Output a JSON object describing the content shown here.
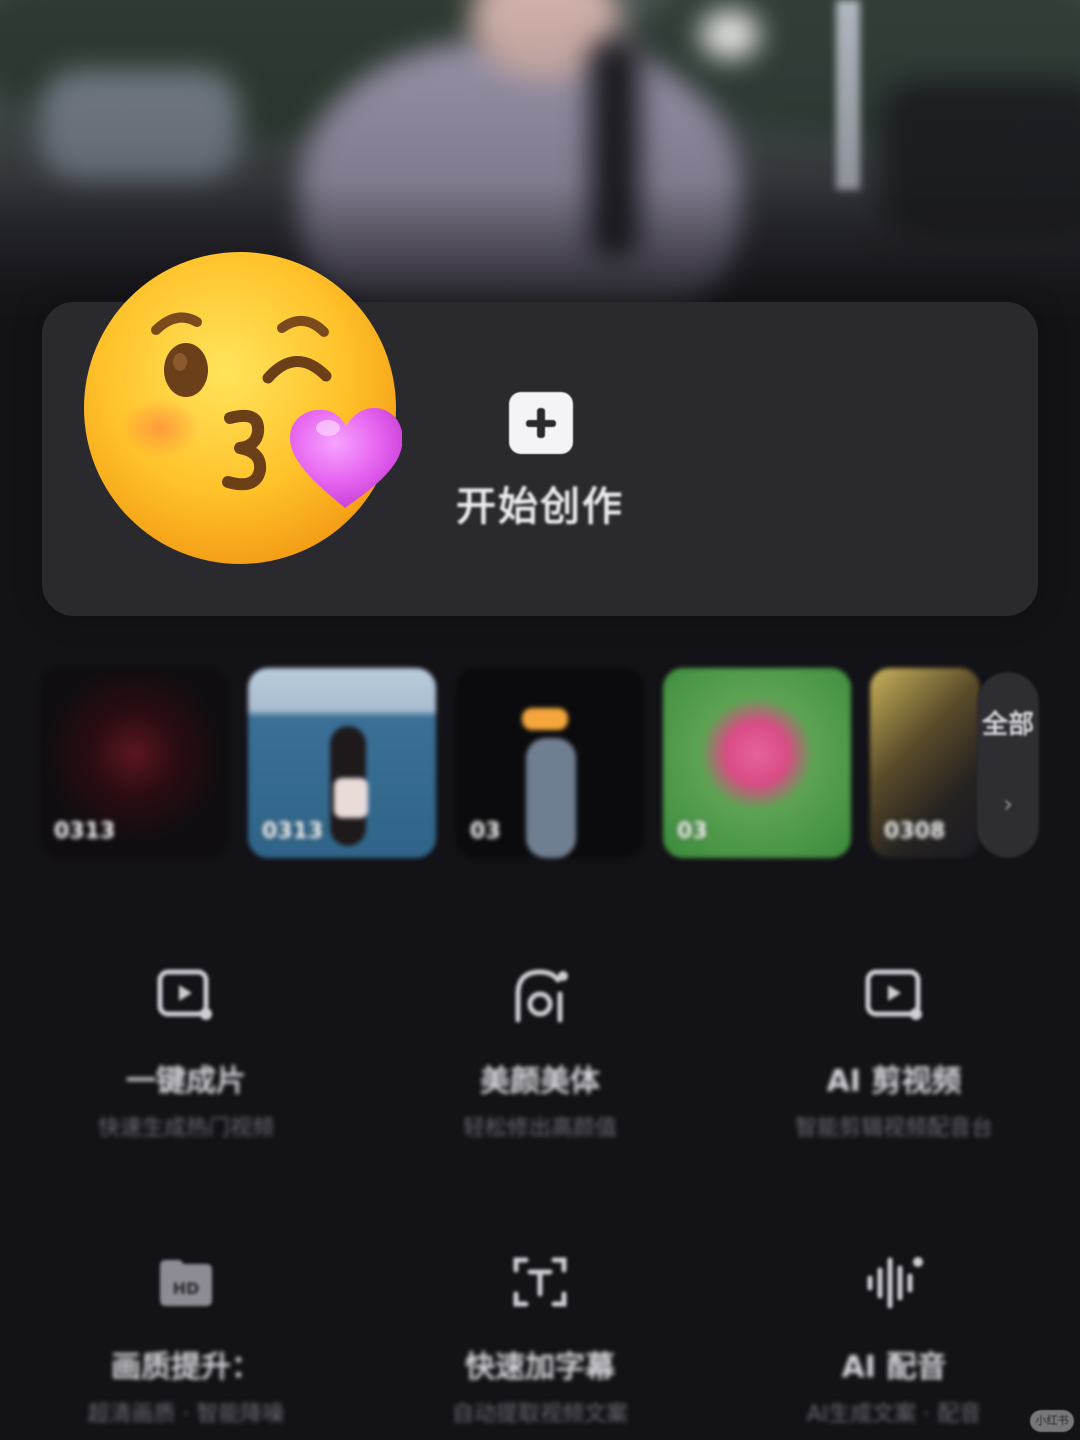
{
  "create": {
    "label": "开始创作",
    "icon": "plus-square-icon"
  },
  "emoji": {
    "icon": "face-blowing-kiss-emoji",
    "heart_color": "#e665f0"
  },
  "drafts": {
    "items": [
      {
        "label": "0313"
      },
      {
        "label": "0313"
      },
      {
        "label": "03"
      },
      {
        "label": "03"
      },
      {
        "label": "0308"
      }
    ],
    "all_label": "全部",
    "all_arrow": "›"
  },
  "tools": [
    {
      "title": "一键成片",
      "desc": "快速生成热门视频",
      "icon": "video-magic-icon"
    },
    {
      "title": "美颜美体",
      "desc": "轻松修出高颜值",
      "icon": "face-beauty-icon"
    },
    {
      "title": "AI 剪视频",
      "desc": "智能剪辑视频配音台",
      "icon": "ai-video-icon"
    },
    {
      "title": "画质提升：",
      "desc": "超清画质 · 智能降噪",
      "icon": "hd-folder-icon"
    },
    {
      "title": "快速加字幕",
      "desc": "自动提取视频文案",
      "icon": "text-scan-icon"
    },
    {
      "title": "AI 配音",
      "desc": "AI生成文案 · 配音",
      "icon": "audio-wave-icon"
    }
  ],
  "watermark": "小红书",
  "colors": {
    "background": "#131217",
    "card": "#2a292e",
    "text": "#e9e9ee",
    "muted": "#6b6a73"
  }
}
